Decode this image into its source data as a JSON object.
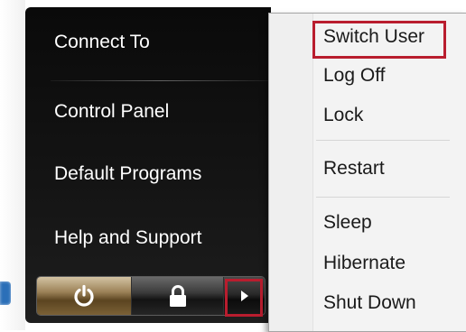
{
  "start_menu": {
    "items": [
      {
        "label": "Connect To"
      },
      {
        "label": "Control Panel"
      },
      {
        "label": "Default Programs"
      },
      {
        "label": "Help and Support"
      }
    ],
    "buttons": {
      "power_icon": "power-icon",
      "lock_icon": "lock-icon",
      "arrow_icon": "arrow-right-icon"
    }
  },
  "flyout": {
    "items": [
      {
        "label": "Switch User"
      },
      {
        "label": "Log Off"
      },
      {
        "label": "Lock"
      },
      {
        "label": "Restart"
      },
      {
        "label": "Sleep"
      },
      {
        "label": "Hibernate"
      },
      {
        "label": "Shut Down"
      }
    ]
  },
  "colors": {
    "highlight": "#b91d2e",
    "menu_background": "#0a0a0a",
    "flyout_background": "#f3f3f3",
    "power_button": "#9b8157"
  }
}
